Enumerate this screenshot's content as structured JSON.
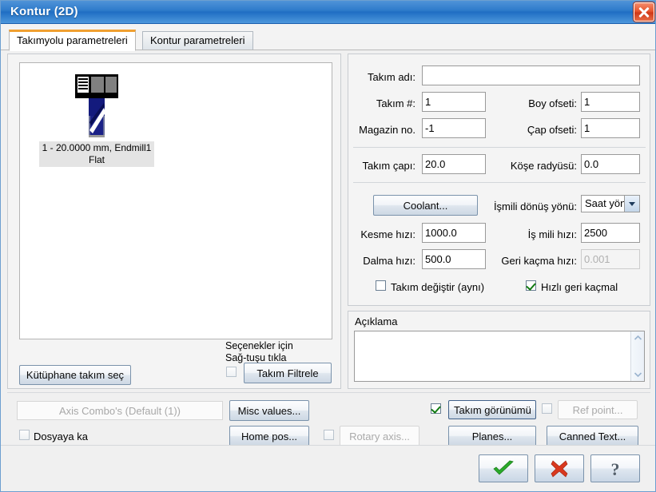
{
  "window": {
    "title": "Kontur  (2D)",
    "close_icon": "close-icon"
  },
  "tabs": [
    {
      "label": "Takımyolu parametreleri",
      "active": true
    },
    {
      "label": "Kontur parametreleri",
      "active": false
    }
  ],
  "tool_panel": {
    "tool_item": {
      "icon": "endmill-tool-icon",
      "label": "1 - 20.0000 mm, Endmill1\nFlat"
    },
    "hint": "Seçenekler için\nSağ-tuşu tıkla",
    "library_button": "Kütüphane takım seç",
    "filter_button": "Takım Filtrele",
    "filter_checkbox": false
  },
  "tool_params": {
    "tool_name": {
      "label": "Takım adı:",
      "value": ""
    },
    "tool_number": {
      "label": "Takım #:",
      "value": "1"
    },
    "length_offset": {
      "label": "Boy ofseti:",
      "value": "1"
    },
    "magazine_no": {
      "label": "Magazin no.",
      "value": "-1"
    },
    "diameter_offset": {
      "label": "Çap ofseti:",
      "value": "1"
    },
    "tool_diameter": {
      "label": "Takım çapı:",
      "value": "20.0"
    },
    "corner_radius": {
      "label": "Köşe radyüsü:",
      "value": "0.0"
    },
    "coolant_button": "Coolant...",
    "spindle_direction": {
      "label": "İşmili dönüş yönü:",
      "value": "Saat yön"
    },
    "feed_rate": {
      "label": "Kesme hızı:",
      "value": "1000.0"
    },
    "spindle_speed": {
      "label": "İş mili hızı:",
      "value": "2500"
    },
    "plunge_rate": {
      "label": "Dalma hızı:",
      "value": "500.0"
    },
    "retract_rate": {
      "label": "Geri kaçma hızı:",
      "value": "0.001",
      "disabled": true
    },
    "tool_change": {
      "label": "Takım değiştir (aynı)",
      "checked": false
    },
    "rapid_retract": {
      "label": "Hızlı geri kaçmal",
      "checked": true
    }
  },
  "description": {
    "label": "Açıklama",
    "value": "",
    "scroll_up_icon": "chevron-up-icon",
    "scroll_down_icon": "chevron-down-icon"
  },
  "bottom_controls": {
    "axis_combo": {
      "value": "Axis Combo's (Default (1))",
      "disabled": true
    },
    "save_to_file": {
      "label": "Dosyaya ka",
      "checked": false
    },
    "misc_values_button": "Misc values...",
    "home_pos_button": "Home pos...",
    "rotary_axis": {
      "label": "Rotary axis...",
      "disabled": true,
      "checked": false
    },
    "tool_display": {
      "label": "Takım görünümü",
      "checked": true
    },
    "ref_point": {
      "label": "Ref point...",
      "disabled": true,
      "checked": false
    },
    "planes_button": "Planes...",
    "canned_text_button": "Canned Text..."
  },
  "footer": {
    "ok": {
      "icon": "check-icon",
      "color": "#2aab2a"
    },
    "cancel": {
      "icon": "x-icon",
      "color": "#d9381e"
    },
    "help": {
      "icon": "question-icon",
      "color": "#4a4a4a"
    }
  }
}
